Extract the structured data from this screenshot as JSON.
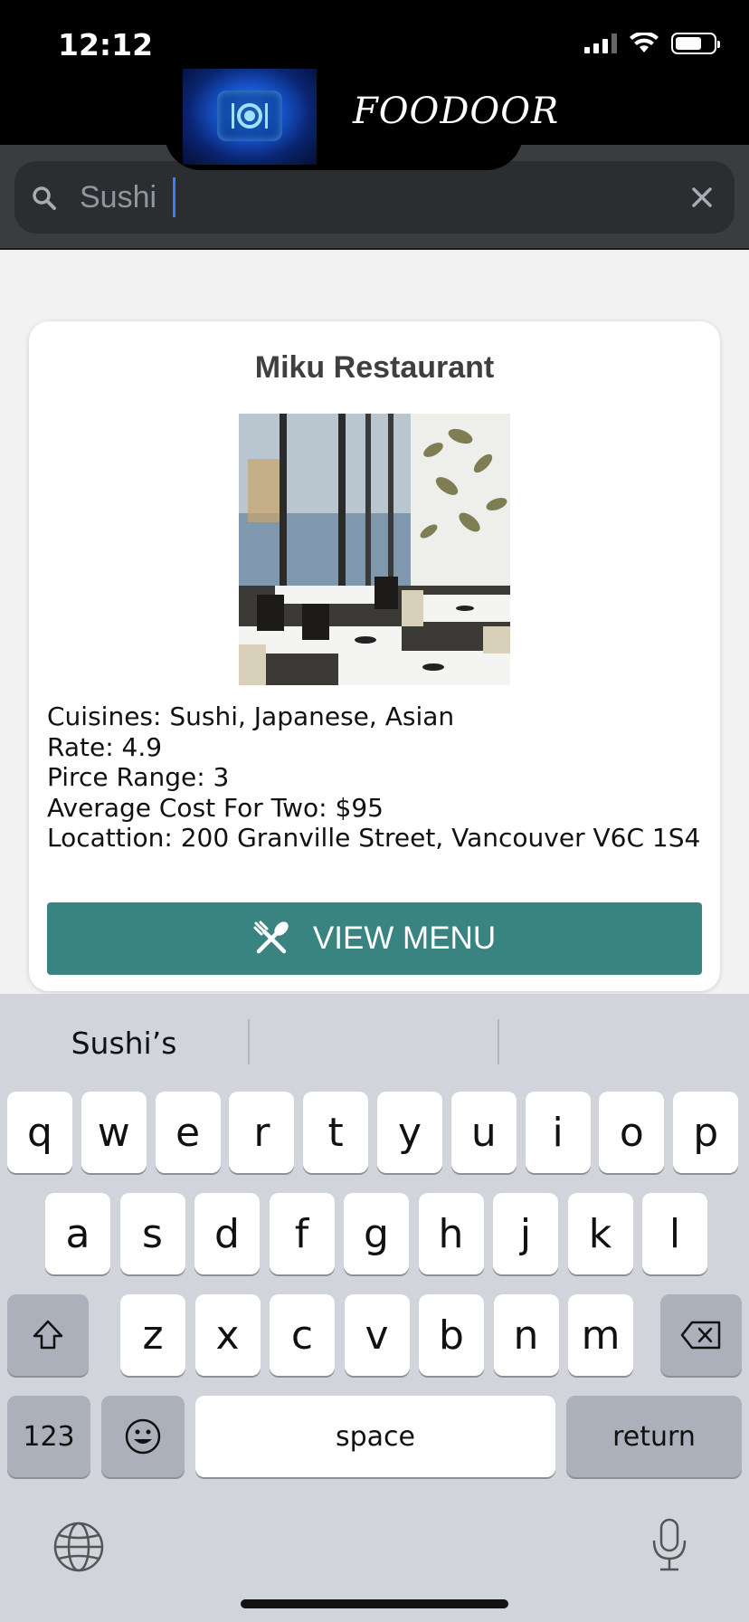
{
  "status_bar": {
    "time": "12:12"
  },
  "header": {
    "brand": "FOODOOR"
  },
  "search": {
    "value": "Sushi",
    "placeholder": ""
  },
  "restaurant": {
    "name": "Miku Restaurant",
    "cuisines": "Cuisines: Sushi, Japanese, Asian",
    "rate": "Rate: 4.9",
    "price_range": "Pirce Range: 3",
    "average_cost": "Average Cost For Two: $95",
    "location": "Locattion: 200 Granville Street, Vancouver V6C 1S4",
    "button_label": "VIEW MENU"
  },
  "keyboard": {
    "suggestions": [
      "Sushi’s",
      "",
      ""
    ],
    "row1": [
      "q",
      "w",
      "e",
      "r",
      "t",
      "y",
      "u",
      "i",
      "o",
      "p"
    ],
    "row2": [
      "a",
      "s",
      "d",
      "f",
      "g",
      "h",
      "j",
      "k",
      "l"
    ],
    "row3": [
      "z",
      "x",
      "c",
      "v",
      "b",
      "n",
      "m"
    ],
    "numbers_label": "123",
    "space_label": "space",
    "return_label": "return"
  },
  "colors": {
    "accent": "#398480",
    "caret": "#3d7bff",
    "header_bg": "#000000",
    "search_bg": "#3a3d40"
  }
}
